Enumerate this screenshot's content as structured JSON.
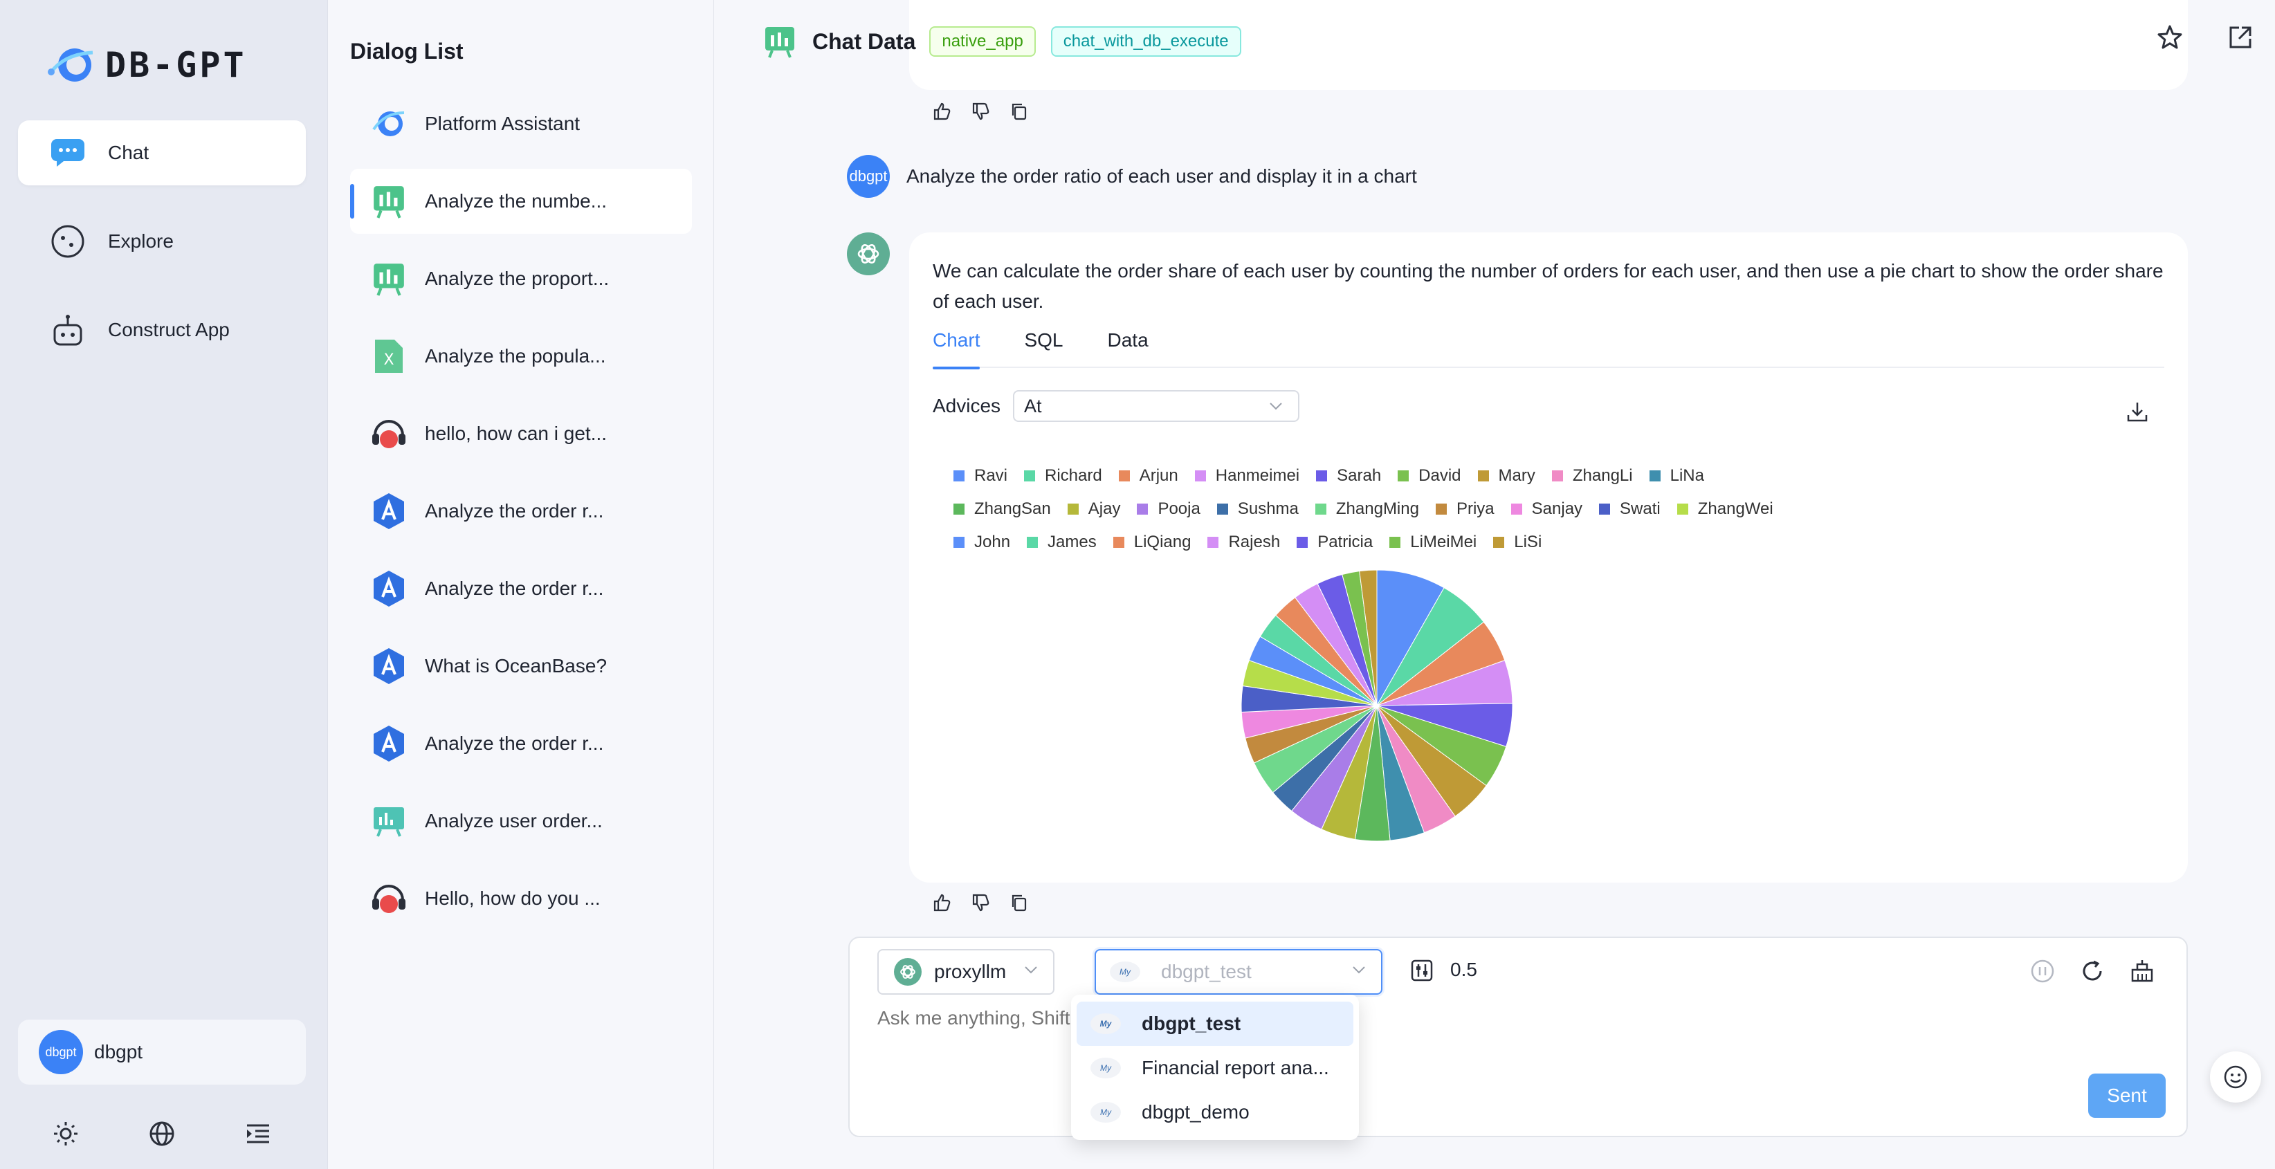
{
  "app": {
    "logo_text": "DB-GPT"
  },
  "nav": {
    "items": [
      {
        "label": "Chat",
        "icon": "chat-bubble-icon",
        "active": true
      },
      {
        "label": "Explore",
        "icon": "compass-icon",
        "active": false
      },
      {
        "label": "Construct App",
        "icon": "robot-icon",
        "active": false
      }
    ],
    "user": {
      "avatar_text": "dbgpt",
      "name": "dbgpt"
    },
    "bottom_icons": [
      "sun-icon",
      "globe-icon",
      "menu-fold-icon"
    ]
  },
  "dialogs": {
    "title": "Dialog List",
    "items": [
      {
        "label": "Platform Assistant",
        "icon": "db-gpt-logo-icon"
      },
      {
        "label": "Analyze the numbe...",
        "icon": "chat-data-icon",
        "active": true
      },
      {
        "label": "Analyze the proport...",
        "icon": "chat-data-icon"
      },
      {
        "label": "Analyze the popula...",
        "icon": "excel-icon"
      },
      {
        "label": "hello, how can i get...",
        "icon": "headset-icon"
      },
      {
        "label": "Analyze the order r...",
        "icon": "agent-app-icon"
      },
      {
        "label": "Analyze the order r...",
        "icon": "agent-app-icon"
      },
      {
        "label": "What is OceanBase?",
        "icon": "agent-app-icon"
      },
      {
        "label": "Analyze the order r...",
        "icon": "agent-app-icon"
      },
      {
        "label": "Analyze user order...",
        "icon": "dashboard-icon"
      },
      {
        "label": "Hello, how do you ...",
        "icon": "headset-icon"
      }
    ]
  },
  "header": {
    "title": "Chat Data",
    "tags": [
      "native_app",
      "chat_with_db_execute"
    ]
  },
  "conversation": {
    "user_avatar": "dbgpt",
    "user_message": "Analyze the order ratio of each user and display it in a chart",
    "bot_message": "We can calculate the order share of each user by counting the number of orders for each user, and then use a pie chart to show the order share of each user.",
    "tabs": [
      "Chart",
      "SQL",
      "Data"
    ],
    "active_tab": "Chart",
    "advices_label": "Advices",
    "advices_value": "At"
  },
  "chart_data": {
    "type": "pie",
    "legend_rows": [
      [
        "Ravi",
        "Richard",
        "Arjun",
        "Hanmeimei",
        "Sarah",
        "David",
        "Mary",
        "ZhangLi",
        "LiNa"
      ],
      [
        "ZhangSan",
        "Ajay",
        "Pooja",
        "Sushma",
        "ZhangMing",
        "Priya",
        "Sanjay",
        "Swati",
        "ZhangWei"
      ],
      [
        "John",
        "James",
        "LiQiang",
        "Rajesh",
        "Patricia",
        "LiMeiMei",
        "LiSi"
      ]
    ],
    "palette": [
      "#5b8ff9",
      "#5ad8a6",
      "#e8895c",
      "#d48ef5",
      "#6b5ce7",
      "#7ac14f",
      "#bf9a36",
      "#f08bc5",
      "#3f8fae",
      "#5cb85c",
      "#b5b83a",
      "#a97de8",
      "#3d6fa8",
      "#6fd88c",
      "#c28a3e",
      "#ee88e0",
      "#4b5fc7",
      "#b6dd4a"
    ],
    "slice_order": [
      "Ravi",
      "Richard",
      "Arjun",
      "Hanmeimei",
      "Sarah",
      "David",
      "Mary",
      "ZhangLi",
      "LiNa",
      "ZhangSan",
      "Ajay",
      "Pooja",
      "Sushma",
      "ZhangMing",
      "Priya",
      "Sanjay",
      "Swati",
      "ZhangWei",
      "John",
      "James",
      "LiQiang",
      "Rajesh",
      "Patricia",
      "LiMeiMei",
      "LiSi"
    ],
    "values": [
      8,
      6,
      5,
      5,
      5,
      5,
      5,
      4,
      4,
      4,
      4,
      4,
      3,
      4,
      3,
      3,
      3,
      3,
      3,
      3,
      3,
      3,
      3,
      2,
      2
    ]
  },
  "input": {
    "model": "proxyllm",
    "database": "dbgpt_test",
    "temperature": "0.5",
    "placeholder": "Ask me anything, Shift + Enter newline",
    "send_label": "Sent",
    "db_options": [
      {
        "label": "dbgpt_test",
        "selected": true
      },
      {
        "label": "Financial report ana...",
        "selected": false
      },
      {
        "label": "dbgpt_demo",
        "selected": false
      }
    ]
  }
}
